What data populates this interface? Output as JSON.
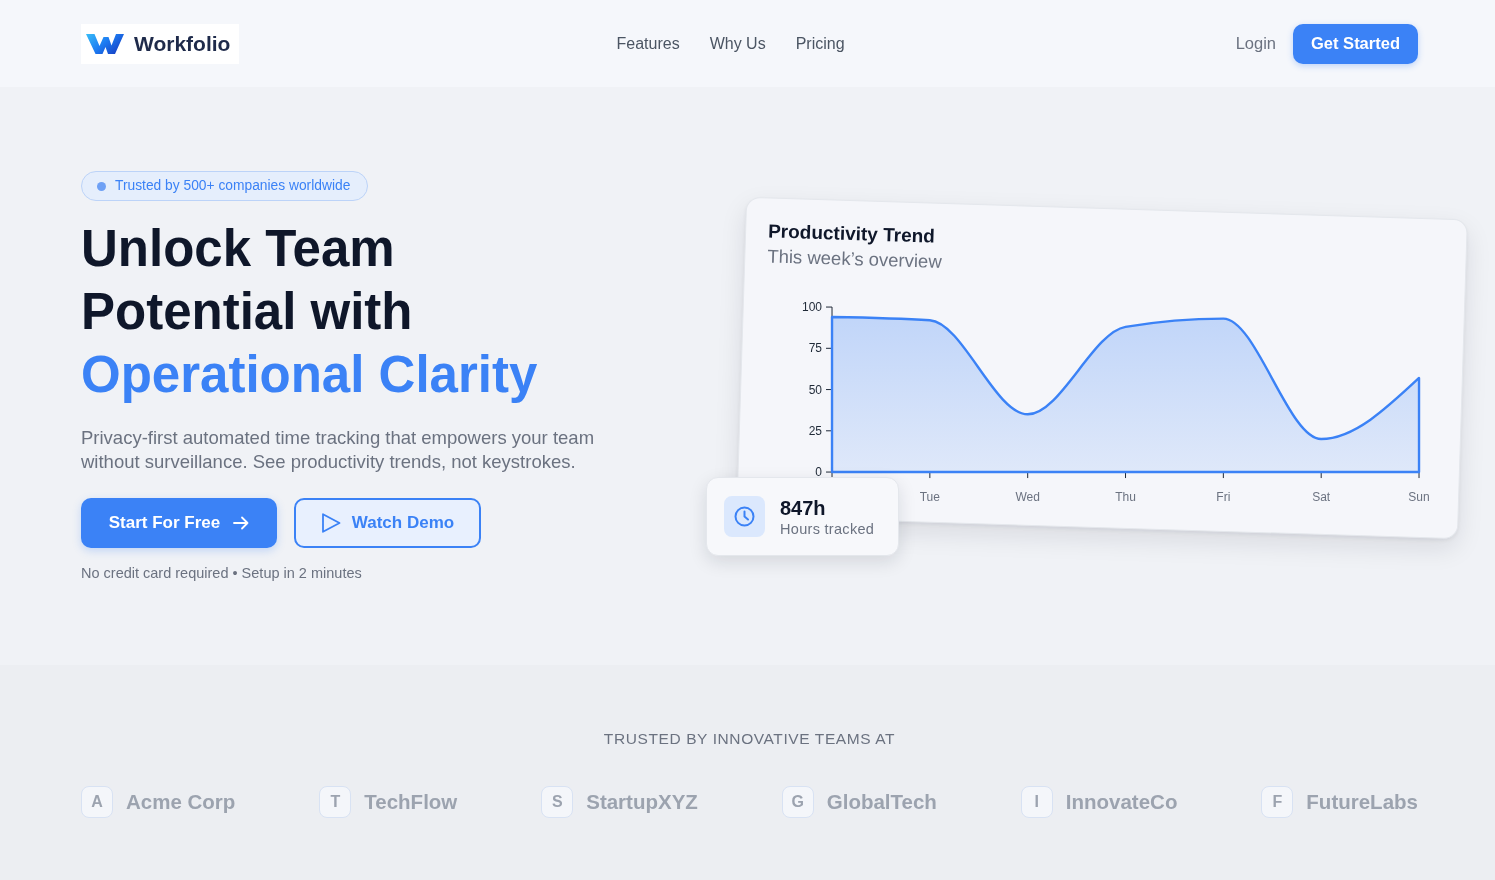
{
  "navbar": {
    "brand": "Workfolio",
    "links": [
      "Features",
      "Why Us",
      "Pricing"
    ],
    "login": "Login",
    "cta": "Get Started"
  },
  "hero": {
    "badge": "Trusted by 500+ companies worldwide",
    "headline": "Unlock Team Potential with",
    "headline_highlight": "Operational Clarity",
    "description": "Privacy-first automated time tracking that empowers your team without surveillance. See productivity trends, not keystrokes.",
    "buttons": [
      {
        "label": "Start For Free",
        "kind": "primary"
      },
      {
        "label": "Watch Demo",
        "kind": "outline"
      }
    ],
    "note": "No credit card required • Setup in 2 minutes"
  },
  "chart_card": {
    "title": "Productivity Trend",
    "subtitle": "This week’s overview",
    "chart_data": {
      "type": "area",
      "categories": [
        null,
        "Tue",
        "Wed",
        "Thu",
        "Fri",
        "Sat",
        "Sun"
      ],
      "series": [
        {
          "color": "#3b82f6",
          "values": [
            94,
            92,
            35,
            88,
            93,
            20,
            57
          ]
        }
      ],
      "ylim": [
        0,
        100
      ],
      "yticks": [
        0,
        25,
        50,
        75,
        100
      ]
    }
  },
  "stat_card": {
    "value": "847h",
    "label": "Hours tracked"
  },
  "trusted": {
    "heading": "TRUSTED BY INNOVATIVE TEAMS AT",
    "companies": [
      {
        "initial": "A",
        "name": "Acme Corp"
      },
      {
        "initial": "T",
        "name": "TechFlow"
      },
      {
        "initial": "S",
        "name": "StartupXYZ"
      },
      {
        "initial": "G",
        "name": "GlobalTech"
      },
      {
        "initial": "I",
        "name": "InnovateCo"
      },
      {
        "initial": "F",
        "name": "FutureLabs"
      }
    ]
  }
}
